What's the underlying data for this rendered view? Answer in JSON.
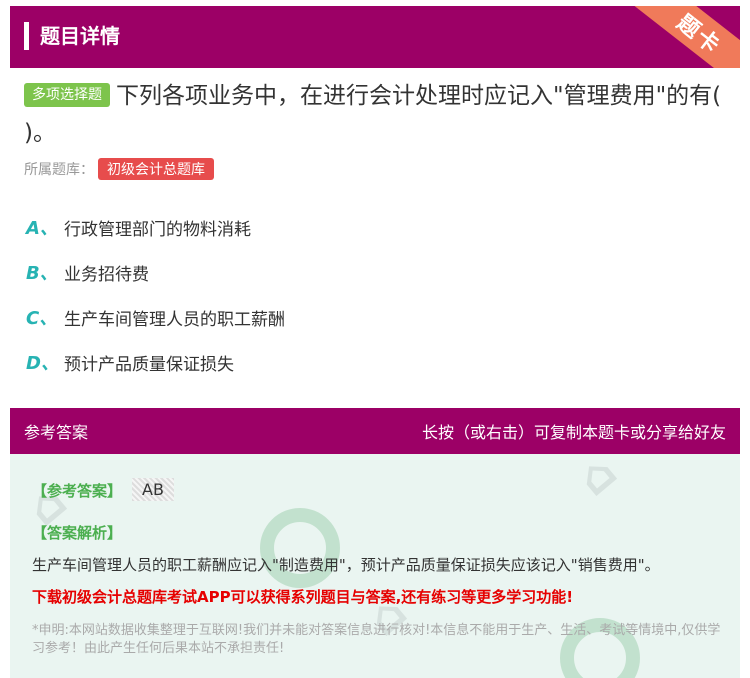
{
  "header": {
    "title": "题目详情",
    "ribbon_label": "题卡"
  },
  "question": {
    "type_badge": "多项选择题",
    "text": "下列各项业务中，在进行会计处理时应记入\"管理费用\"的有( )。"
  },
  "bank": {
    "label": "所属题库：",
    "name": "初级会计总题库"
  },
  "options": [
    {
      "letter": "A、",
      "text": "行政管理部门的物料消耗"
    },
    {
      "letter": "B、",
      "text": "业务招待费"
    },
    {
      "letter": "C、",
      "text": "生产车间管理人员的职工薪酬"
    },
    {
      "letter": "D、",
      "text": "预计产品质量保证损失"
    }
  ],
  "answer_section": {
    "title": "参考答案",
    "share_hint": "长按（或右击）可复制本题卡或分享给好友",
    "answer_label": "【参考答案】",
    "answer_value": "AB",
    "explanation_label": "【答案解析】",
    "explanation": "生产车间管理人员的职工薪酬应记入\"制造费用\"，预计产品质量保证损失应该记入\"销售费用\"。",
    "promo": "下载初级会计总题库考试APP可以获得系列题目与答案,还有练习等更多学习功能!",
    "disclaimer": "*申明:本网站数据收集整理于互联网!我们并未能对答案信息进行核对!本信息不能用于生产、生活、考试等情境中,仅供学习参考！由此产生任何后果本站不承担责任!"
  },
  "colors": {
    "brand": "#9c0066",
    "option_letter": "#27b3b3",
    "badge_green": "#7dc44c",
    "badge_red": "#e74c4c",
    "promo_red": "#e60000",
    "answer_green": "#4caf50"
  }
}
